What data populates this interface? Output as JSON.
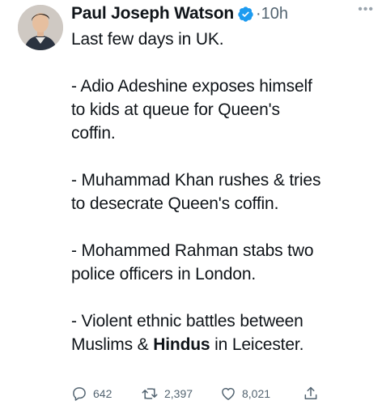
{
  "tweet": {
    "author_name": "Paul Joseph Watson",
    "separator": "·",
    "time": "10h",
    "more_glyph": "•••",
    "lines": [
      "Last few days in UK.",
      "",
      "- Adio Adeshine exposes himself",
      "to kids at queue for Queen's",
      "coffin.",
      "",
      "- Muhammad Khan rushes & tries",
      "to desecrate Queen's coffin.",
      "",
      "- Mohammed Rahman stabs two",
      "police officers in London.",
      "",
      "- Violent ethnic battles between"
    ],
    "last_line": {
      "before": "Muslims & ",
      "bold": "Hindus",
      "after": " in Leicester."
    }
  },
  "actions": {
    "replies": "642",
    "retweets": "2,397",
    "likes": "8,021"
  },
  "icons": {
    "verified": "verified-badge-icon",
    "reply": "reply-icon",
    "retweet": "retweet-icon",
    "like": "heart-icon",
    "share": "share-icon",
    "more": "more-icon"
  },
  "colors": {
    "verified": "#1d9bf0",
    "muted": "#536471",
    "text": "#0f1419"
  }
}
